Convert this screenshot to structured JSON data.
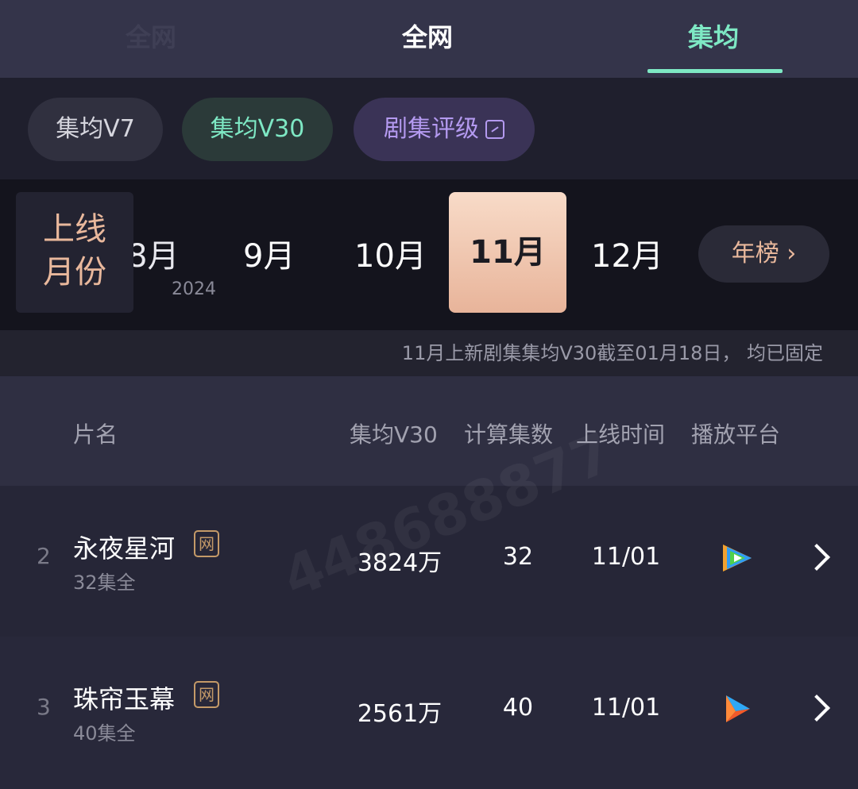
{
  "top_tabs": {
    "faded_label": "全网",
    "all": "全网",
    "active": "集均"
  },
  "chips": {
    "v7": "集均V7",
    "v30": "集均V30",
    "rating": "剧集评级"
  },
  "months": {
    "section_label_line1": "上线",
    "section_label_line2": "月份",
    "m8": "8月",
    "year": "2024",
    "m9": "9月",
    "m10": "10月",
    "selected": "11月",
    "m12": "12月",
    "year_button": "年榜 ›"
  },
  "notice": "11月上新剧集集均V30截至01月18日， 均已固定",
  "table": {
    "headers": {
      "name": "片名",
      "v30": "集均V30",
      "count": "计算集数",
      "date": "上线时间",
      "platform": "播放平台"
    },
    "rows": [
      {
        "rank": "2",
        "title": "永夜星河",
        "badge": "网",
        "episodes_note": "32集全",
        "v30": "3824万",
        "count": "32",
        "date": "11/01",
        "platform_icon": "tencent-video-icon"
      },
      {
        "rank": "3",
        "title": "珠帘玉幕",
        "badge": "网",
        "episodes_note": "40集全",
        "v30": "2561万",
        "count": "40",
        "date": "11/01",
        "platform_icon": "youku-icon"
      }
    ]
  },
  "watermark": "448688877",
  "colors": {
    "accent_mint": "#7ee8c4",
    "accent_purple": "#b49af0",
    "accent_peach": "#e9b89c",
    "badge_gold": "#c49a68"
  }
}
